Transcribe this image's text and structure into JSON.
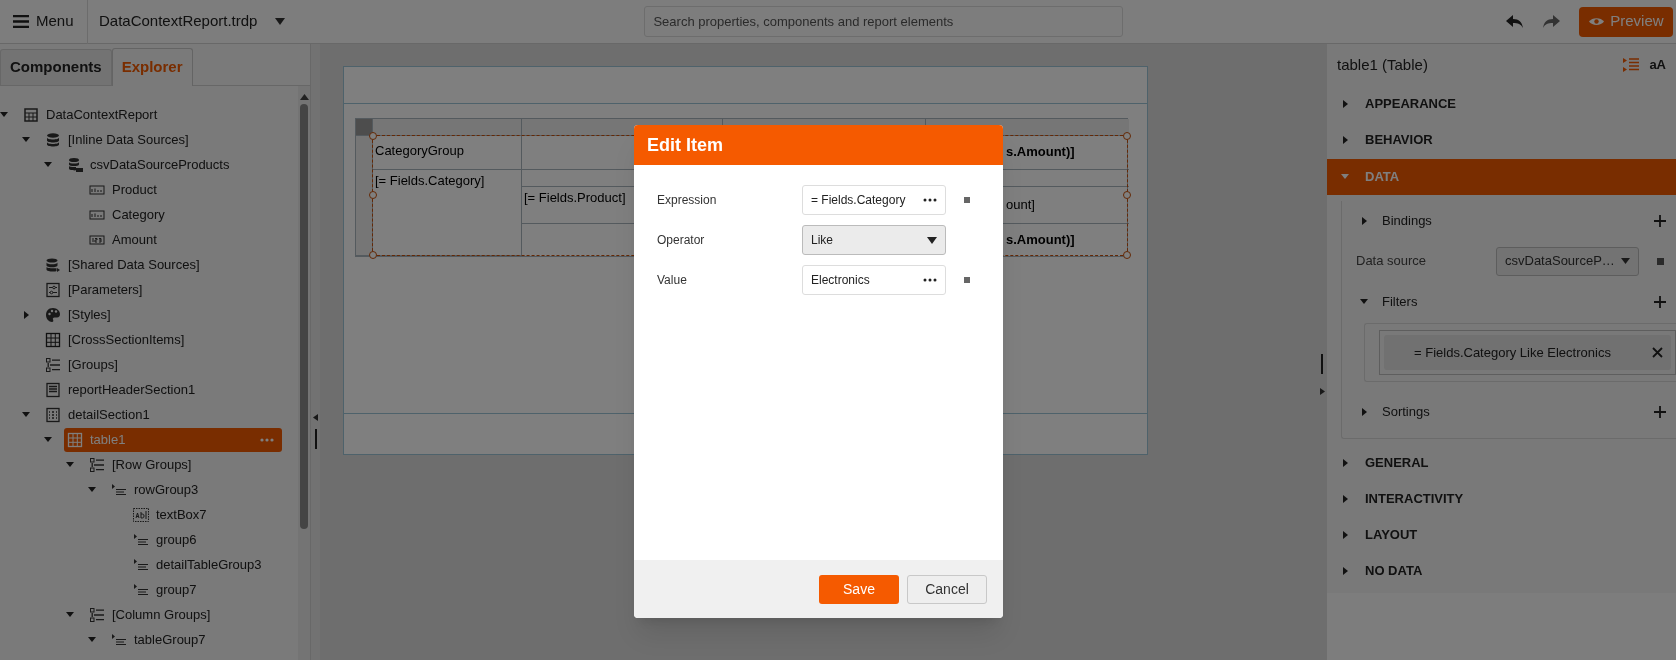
{
  "toolbar": {
    "menu_label": "Menu",
    "file_name": "DataContextReport.trdp",
    "search": {
      "placeholder": "Search properties, components and report elements"
    },
    "preview_label": "Preview"
  },
  "left_panel": {
    "tabs": [
      {
        "label": "Components",
        "selected": false
      },
      {
        "label": "Explorer",
        "selected": true
      }
    ],
    "tree": [
      {
        "label": "DataContextReport",
        "kind": "report",
        "expanded": true,
        "selected": false,
        "children": [
          {
            "label": "[Inline Data Sources]",
            "kind": "database",
            "expanded": true,
            "selected": false,
            "children": [
              {
                "label": "csvDataSourceProducts",
                "kind": "csv",
                "expanded": true,
                "selected": false,
                "children": [
                  {
                    "label": "Product",
                    "kind": "text-field",
                    "selected": false
                  },
                  {
                    "label": "Category",
                    "kind": "text-field",
                    "selected": false
                  },
                  {
                    "label": "Amount",
                    "kind": "number-field",
                    "selected": false
                  }
                ]
              }
            ]
          },
          {
            "label": "[Shared Data Sources]",
            "kind": "shared",
            "selected": false
          },
          {
            "label": "[Parameters]",
            "kind": "parameters",
            "selected": false
          },
          {
            "label": "[Styles]",
            "kind": "styles",
            "expanded": false,
            "selected": false
          },
          {
            "label": "[CrossSectionItems]",
            "kind": "grid",
            "selected": false
          },
          {
            "label": "[Groups]",
            "kind": "groups",
            "selected": false
          },
          {
            "label": "reportHeaderSection1",
            "kind": "section",
            "selected": false
          },
          {
            "label": "detailSection1",
            "kind": "detail",
            "expanded": true,
            "selected": false,
            "children": [
              {
                "label": "table1",
                "kind": "grid",
                "expanded": true,
                "selected": true,
                "children": [
                  {
                    "label": "[Row Groups]",
                    "kind": "groups",
                    "expanded": true,
                    "selected": false,
                    "children": [
                      {
                        "label": "rowGroup3",
                        "kind": "group",
                        "expanded": true,
                        "selected": false,
                        "children": [
                          {
                            "label": "textBox7",
                            "kind": "textbox",
                            "selected": false
                          },
                          {
                            "label": "group6",
                            "kind": "group",
                            "selected": false
                          },
                          {
                            "label": "detailTableGroup3",
                            "kind": "group",
                            "selected": false
                          },
                          {
                            "label": "group7",
                            "kind": "group",
                            "selected": false
                          }
                        ]
                      }
                    ]
                  },
                  {
                    "label": "[Column Groups]",
                    "kind": "groups",
                    "expanded": true,
                    "selected": false,
                    "children": [
                      {
                        "label": "tableGroup7",
                        "kind": "group",
                        "expanded": true,
                        "selected": false
                      }
                    ]
                  }
                ]
              }
            ]
          }
        ]
      }
    ]
  },
  "design_table": {
    "selected": true,
    "group_header": "CategoryGroup",
    "group_value": "[= Fields.Category]",
    "detail_value": "[= Fields.Product]",
    "right_column": [
      {
        "text": "s.Amount)]",
        "bold": true
      },
      {
        "text": "ount]",
        "bold": false
      },
      {
        "text": "s.Amount)]",
        "bold": true
      }
    ]
  },
  "dialog": {
    "title": "Edit Item",
    "fields": [
      {
        "label": "Expression",
        "kind": "expression",
        "value": "= Fields.Category"
      },
      {
        "label": "Operator",
        "kind": "dropdown",
        "value": "Like"
      },
      {
        "label": "Value",
        "kind": "expression",
        "value": "Electronics"
      }
    ],
    "buttons": [
      {
        "label": "Save",
        "kind": "primary"
      },
      {
        "label": "Cancel",
        "kind": "secondary"
      }
    ]
  },
  "properties": {
    "title": "table1 (Table)",
    "text_size_label": "aA",
    "sections": [
      {
        "label": "APPEARANCE",
        "expanded": false
      },
      {
        "label": "BEHAVIOR",
        "expanded": false
      },
      {
        "label": "DATA",
        "expanded": true,
        "items": [
          {
            "kind": "group",
            "label": "Bindings",
            "expanded": false
          },
          {
            "kind": "dropdown",
            "label": "Data source",
            "value": "csvDataSourceP…"
          },
          {
            "kind": "group",
            "label": "Filters",
            "expanded": true,
            "entries": [
              "= Fields.Category Like Electronics"
            ]
          },
          {
            "kind": "group",
            "label": "Sortings",
            "expanded": false
          }
        ]
      },
      {
        "label": "GENERAL",
        "expanded": false
      },
      {
        "label": "INTERACTIVITY",
        "expanded": false
      },
      {
        "label": "LAYOUT",
        "expanded": false
      },
      {
        "label": "NO DATA",
        "expanded": false
      }
    ]
  }
}
